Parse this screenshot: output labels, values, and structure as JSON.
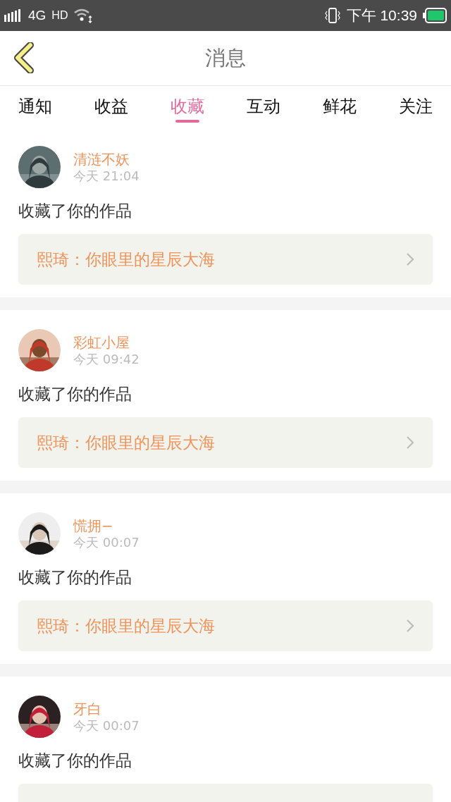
{
  "status_bar": {
    "network": "4G",
    "hd": "HD",
    "time": "下午 10:39"
  },
  "header": {
    "title": "消息"
  },
  "tabs": [
    {
      "label": "通知",
      "selected": false
    },
    {
      "label": "收益",
      "selected": false
    },
    {
      "label": "收藏",
      "selected": true
    },
    {
      "label": "互动",
      "selected": false
    },
    {
      "label": "鲜花",
      "selected": false
    },
    {
      "label": "关注",
      "selected": false
    }
  ],
  "messages": [
    {
      "name": "清涟不妖",
      "time": "今天 21:04",
      "action": "收藏了你的作品",
      "work": "熙琦：你眼里的星辰大海"
    },
    {
      "name": "彩虹小屋",
      "time": "今天 09:42",
      "action": "收藏了你的作品",
      "work": "熙琦：你眼里的星辰大海"
    },
    {
      "name": "慌拥−",
      "time": "今天 00:07",
      "action": "收藏了你的作品",
      "work": "熙琦：你眼里的星辰大海"
    },
    {
      "name": "牙白",
      "time": "今天 00:07",
      "action": "收藏了你的作品"
    }
  ]
}
